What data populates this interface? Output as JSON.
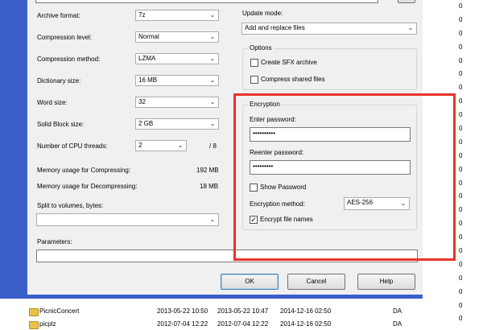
{
  "background": {
    "zeros": [
      "0",
      "0",
      "0",
      "0",
      "0",
      "0",
      "0",
      "0",
      "0",
      "0",
      "0",
      "0",
      "0",
      "0",
      "0",
      "0",
      "0",
      "0",
      "0",
      "0",
      "0",
      "0",
      "0",
      "0"
    ],
    "files": [
      {
        "name": "PicnicConcert",
        "modified": "2013-05-22 10:50",
        "created": "2013-05-22 10:47",
        "accessed": "2014-12-16 02:50",
        "attr": "DA",
        "size": "0"
      },
      {
        "name": "picplz",
        "modified": "2012-07-04 12:22",
        "created": "2012-07-04 12:22",
        "accessed": "2014-12-16 02:50",
        "attr": "DA",
        "size": "0"
      }
    ]
  },
  "dialog": {
    "left": {
      "archive_format": {
        "label": "Archive format:",
        "value": "7z"
      },
      "compression_level": {
        "label": "Compression level:",
        "value": "Normal"
      },
      "compression_method": {
        "label": "Compression method:",
        "value": "LZMA"
      },
      "dictionary_size": {
        "label": "Dictionary size:",
        "value": "16 MB"
      },
      "word_size": {
        "label": "Word size:",
        "value": "32"
      },
      "solid_block_size": {
        "label": "Solid Block size:",
        "value": "2 GB"
      },
      "cpu_threads": {
        "label": "Number of CPU threads:",
        "value": "2",
        "max": "/ 8"
      },
      "mem_compress": {
        "label": "Memory usage for Compressing:",
        "value": "192 MB"
      },
      "mem_decompress": {
        "label": "Memory usage for Decompressing:",
        "value": "18 MB"
      },
      "split": {
        "label": "Split to volumes, bytes:",
        "value": ""
      },
      "parameters": {
        "label": "Parameters:",
        "value": ""
      }
    },
    "right": {
      "update_mode": {
        "label": "Update mode:",
        "value": "Add and replace files"
      },
      "options": {
        "title": "Options",
        "create_sfx": "Create SFX archive",
        "compress_shared": "Compress shared files"
      },
      "encryption": {
        "title": "Encryption",
        "enter_password_label": "Enter password:",
        "enter_password_value": "••••••••••",
        "reenter_password_label": "Reenter password:",
        "reenter_password_value": "•••••••••",
        "show_password": "Show Password",
        "method_label": "Encryption method:",
        "method_value": "AES-256",
        "encrypt_names": "Encrypt file names"
      }
    },
    "buttons": {
      "ok": "OK",
      "cancel": "Cancel",
      "help": "Help"
    }
  },
  "colors": {
    "frame": "#3b5fc8",
    "highlight": "#e8322c",
    "dialog_bg": "#f0f0f0"
  }
}
